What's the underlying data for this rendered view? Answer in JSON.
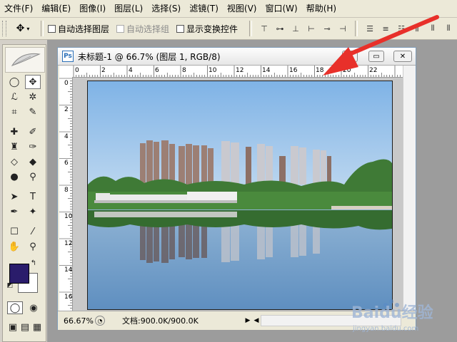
{
  "menu": [
    "文件(F)",
    "编辑(E)",
    "图像(I)",
    "图层(L)",
    "选择(S)",
    "滤镜(T)",
    "视图(V)",
    "窗口(W)",
    "帮助(H)"
  ],
  "options": {
    "auto_select_layer": "自动选择图层",
    "auto_select_group": "自动选择组",
    "show_transform": "显示变换控件"
  },
  "document": {
    "title": "未标题-1 @ 66.7% (图层 1, RGB/8)",
    "zoom": "66.67%",
    "info": "文档:900.0K/900.0K"
  },
  "rulers": {
    "horizontal": [
      "0",
      "2",
      "4",
      "6",
      "8",
      "10",
      "12",
      "14",
      "16",
      "18",
      "20",
      "22"
    ],
    "vertical": [
      "0",
      "2",
      "4",
      "6",
      "8",
      "10",
      "12",
      "14",
      "16"
    ]
  },
  "watermark": {
    "brand": "Baidu经验",
    "url": "jingyan.baidu.com"
  },
  "colors": {
    "foreground": "#2a1c6b",
    "background": "#ffffff",
    "arrow": "#e8302a"
  }
}
